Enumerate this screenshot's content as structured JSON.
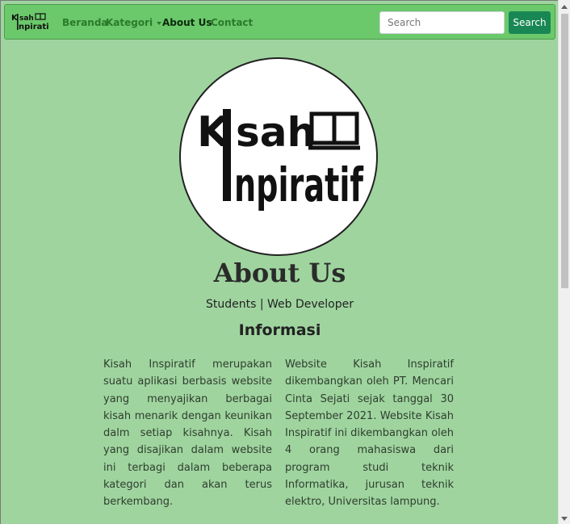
{
  "navbar": {
    "brand_logo_text": "Kisah Inpiratif",
    "links": [
      {
        "label": "Beranda"
      },
      {
        "label": "Kategori"
      },
      {
        "label": "About Us"
      },
      {
        "label": "Contact"
      }
    ],
    "search_placeholder": "Search",
    "search_button_label": "Search"
  },
  "hero": {
    "logo_text_line1": "K",
    "logo_text_line1b": "sah",
    "logo_text_line2": "npiratif",
    "logo_icon": "open-book-icon"
  },
  "about": {
    "title": "About Us",
    "subtitle": "Students | Web Developer",
    "section_heading": "Informasi",
    "paragraph_left": "Kisah Inspiratif merupakan suatu aplikasi berbasis website yang menyajikan berbagai kisah menarik dengan keunikan dalm setiap kisahnya. Kisah yang disajikan dalam website ini terbagi dalam beberapa kategori dan akan terus berkembang.",
    "paragraph_right": "Website Kisah Inspiratif dikembangkan oleh PT. Mencari Cinta Sejati sejak tanggal 30 September 2021. Website Kisah Inspiratif ini dikembangkan oleh 4 orang mahasiswa dari program studi teknik Informatika, jurusan teknik elektro, Universitas lampung."
  },
  "colors": {
    "page_background": "#9fd49f",
    "navbar_background": "#6bc96b",
    "search_button": "#198754"
  }
}
